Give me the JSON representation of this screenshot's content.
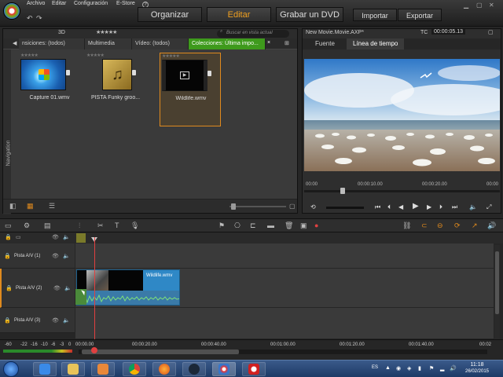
{
  "menu": {
    "items": [
      "Archivo",
      "Editar",
      "Configuración",
      "E-Store"
    ],
    "help_icon": "?"
  },
  "modes": {
    "organize": "Organizar",
    "edit": "Editar",
    "disc": "Grabar un DVD",
    "import": "Importar",
    "export": "Exportar"
  },
  "library": {
    "view_3d": "3D",
    "rating": "★★★★★",
    "search_placeholder": "Buscar en vista actual",
    "tabs": [
      "nsiciones: (todos)",
      "Multimedia",
      "Vídeo: (todos)",
      "Colecciones: Última impo..."
    ],
    "tab_close": "×",
    "nav_label": "Navigation",
    "items": [
      {
        "name": "Capture 01.wmv",
        "stars": "★★★★★"
      },
      {
        "name": "PISTA Funky groo...",
        "stars": "★★★★★"
      },
      {
        "name": "Wildlife.wmv",
        "stars": "★★★★★"
      }
    ]
  },
  "player": {
    "project": "New Movie.Movie.AXP*",
    "tc_label": "TC",
    "timecode": "00:00:05.13",
    "tabs": [
      "Fuente",
      "Línea de tiempo"
    ],
    "ruler": [
      "00:00",
      "00:00:10.00",
      "00:00:20.00",
      "00:00"
    ]
  },
  "timeline": {
    "tracks": [
      "Pista A/V (1)",
      "Pista A/V (2)",
      "Pista A/V (3)"
    ],
    "clip_name": "Wildlife.wmv",
    "timecodes": [
      "00:00.00",
      "00:00:20.00",
      "00:00:40.00",
      "00:01:00.00",
      "00:01:20.00",
      "00:01:40.00",
      "00:02"
    ],
    "vu_levels": [
      "-60",
      "-22",
      "-16",
      "-10",
      "-6",
      "-3",
      "0"
    ]
  },
  "taskbar": {
    "lang": "ES",
    "time": "11:18",
    "date": "26/02/2015"
  },
  "colors": {
    "accent_orange": "#f0a020",
    "collection_green": "#3e9a1c",
    "clip_blue": "#2f88c6",
    "playhead_red": "#e04040"
  }
}
